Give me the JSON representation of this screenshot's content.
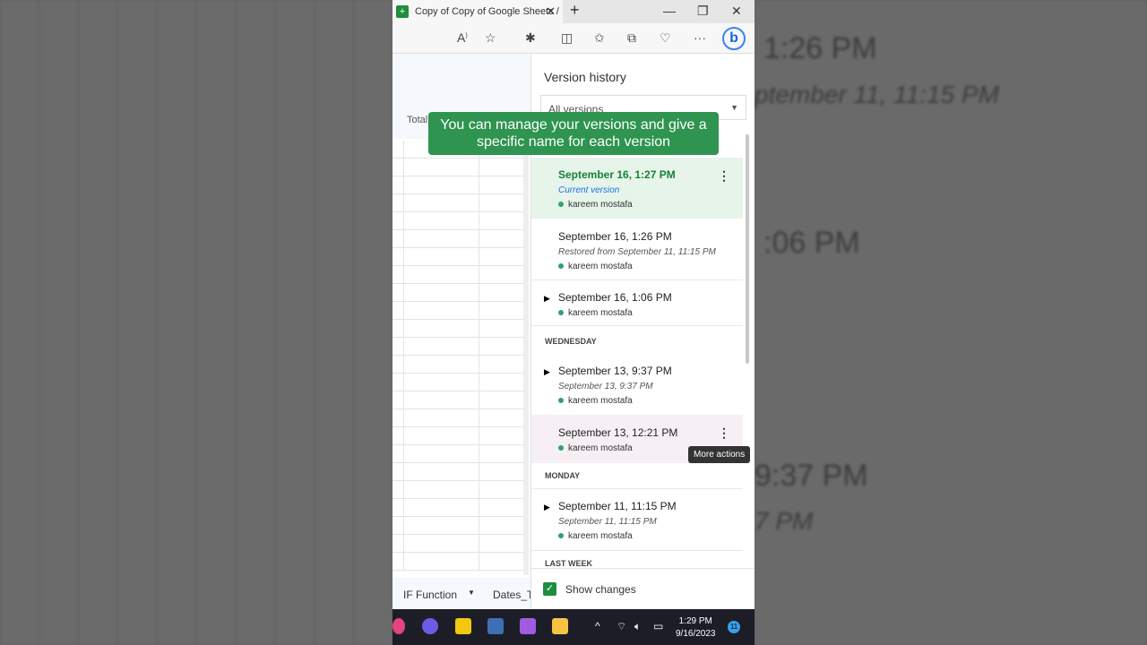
{
  "background": {
    "right_ghost": [
      "1:26 PM",
      "ptember 11, 11:15 PM",
      ":06 PM",
      "9:37 PM",
      "7 PM"
    ]
  },
  "browser": {
    "tab_title": "Copy of Copy of Google Sheets /",
    "tab_icon": "google-sheets-icon",
    "new_tab": "+",
    "minimize": "—",
    "restore": "❐",
    "close": "✕"
  },
  "sheet": {
    "header_partial": "Total",
    "sheet_tabs": [
      "IF Function",
      "Dates_T"
    ]
  },
  "caption": "You can manage your versions and give a specific name for each version",
  "version_history": {
    "title": "Version history",
    "filter": "All versions",
    "entries": [
      {
        "time": "September 16, 1:27 PM",
        "sub": "Current version",
        "user": "kareem mostafa"
      },
      {
        "time": "September 16, 1:26 PM",
        "sub": "Restored from September 11, 11:15 PM",
        "user": "kareem mostafa"
      },
      {
        "time": "September 16, 1:06 PM",
        "user": "kareem mostafa"
      },
      {
        "time": "September 13, 9:37 PM",
        "sub": "September 13, 9:37 PM",
        "user": "kareem mostafa"
      },
      {
        "time": "September 13, 12:21 PM",
        "user": "kareem mostafa"
      },
      {
        "time": "September 11, 11:15 PM",
        "sub": "September 11, 11:15 PM",
        "user": "kareem mostafa"
      }
    ],
    "sections": [
      "WEDNESDAY",
      "MONDAY",
      "LAST WEEK"
    ],
    "tooltip": "More actions",
    "show_changes": "Show changes",
    "show_changes_checked": true,
    "accent": "#1e8e3e"
  },
  "taskbar": {
    "time": "1:29 PM",
    "date": "9/16/2023",
    "notifications": "11"
  }
}
